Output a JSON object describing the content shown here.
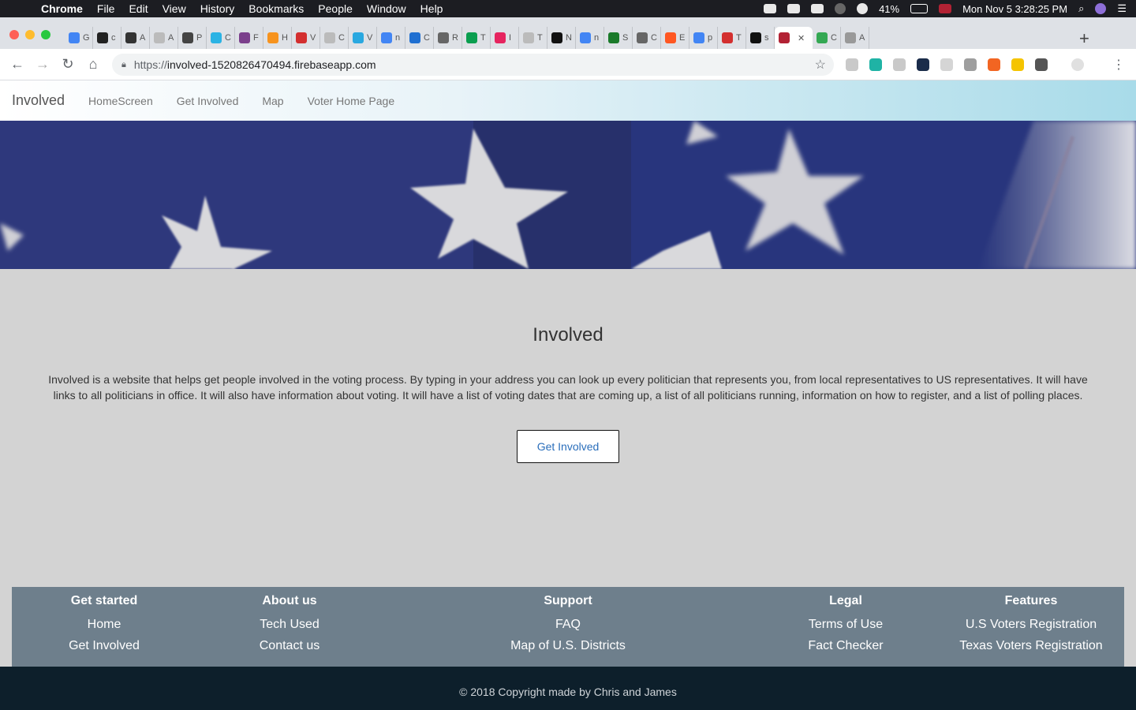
{
  "menubar": {
    "app": "Chrome",
    "items": [
      "File",
      "Edit",
      "View",
      "History",
      "Bookmarks",
      "People",
      "Window",
      "Help"
    ],
    "battery": "41%",
    "datetime": "Mon Nov 5  3:28:25 PM"
  },
  "browser": {
    "url_prefix": "https://",
    "url_host": "involved-1520826470494.firebaseapp.com",
    "tabs": [
      {
        "label": "G",
        "color": "#4285f4"
      },
      {
        "label": "c",
        "color": "#222222"
      },
      {
        "label": "A",
        "color": "#333333"
      },
      {
        "label": "A",
        "color": "#bbbbbb"
      },
      {
        "label": "P",
        "color": "#444444"
      },
      {
        "label": "C",
        "color": "#2bb3e4"
      },
      {
        "label": "F",
        "color": "#7b3f8c"
      },
      {
        "label": "H",
        "color": "#f7931e"
      },
      {
        "label": "V",
        "color": "#d32f2f"
      },
      {
        "label": "C",
        "color": "#bbbbbb"
      },
      {
        "label": "V",
        "color": "#29a8e0"
      },
      {
        "label": "n",
        "color": "#4285f4"
      },
      {
        "label": "C",
        "color": "#1f6fd1"
      },
      {
        "label": "R",
        "color": "#666666"
      },
      {
        "label": "T",
        "color": "#0a9e4f"
      },
      {
        "label": "I",
        "color": "#e6245f"
      },
      {
        "label": "T",
        "color": "#bbbbbb"
      },
      {
        "label": "N",
        "color": "#111111"
      },
      {
        "label": "n",
        "color": "#4285f4"
      },
      {
        "label": "S",
        "color": "#1a7a2a"
      },
      {
        "label": "C",
        "color": "#666666"
      },
      {
        "label": "E",
        "color": "#ff5722"
      },
      {
        "label": "p",
        "color": "#4285f4"
      },
      {
        "label": "T",
        "color": "#d32f2f"
      },
      {
        "label": "s",
        "color": "#111111"
      }
    ],
    "active_tab_color": "#b22234",
    "last_tab": {
      "label": "C",
      "color": "#34a853"
    },
    "extra_tab": {
      "label": "A",
      "color": "#999999"
    },
    "extension_colors": [
      "#c9c9c9",
      "#1fb3a5",
      "#c9c9c9",
      "#1a2c4a",
      "#d5d5d5",
      "#9e9e9e",
      "#f26522",
      "#f5c400",
      "#555555"
    ]
  },
  "site": {
    "brand": "Involved",
    "nav": [
      "HomeScreen",
      "Get Involved",
      "Map",
      "Voter Home Page"
    ],
    "heading": "Involved",
    "description": "Involved is a website that helps get people involved in the voting process. By typing in your address you can look up every politician that represents you, from local representatives to US representatives. It will have links to all politicians in office. It will also have information about voting. It will have a list of voting dates that are coming up, a list of all politicians running, information on how to register, and a list of polling places.",
    "cta": "Get Involved",
    "footer": [
      {
        "title": "Get started",
        "links": [
          "Home",
          "Get Involved"
        ]
      },
      {
        "title": "About us",
        "links": [
          "Tech Used",
          "Contact us"
        ]
      },
      {
        "title": "Support",
        "links": [
          "FAQ",
          "Map of U.S. Districts"
        ]
      },
      {
        "title": "Legal",
        "links": [
          "Terms of Use",
          "Fact Checker"
        ]
      },
      {
        "title": "Features",
        "links": [
          "U.S Voters Registration",
          "Texas Voters Registration"
        ]
      }
    ],
    "copyright": "© 2018 Copyright made by Chris and James"
  }
}
